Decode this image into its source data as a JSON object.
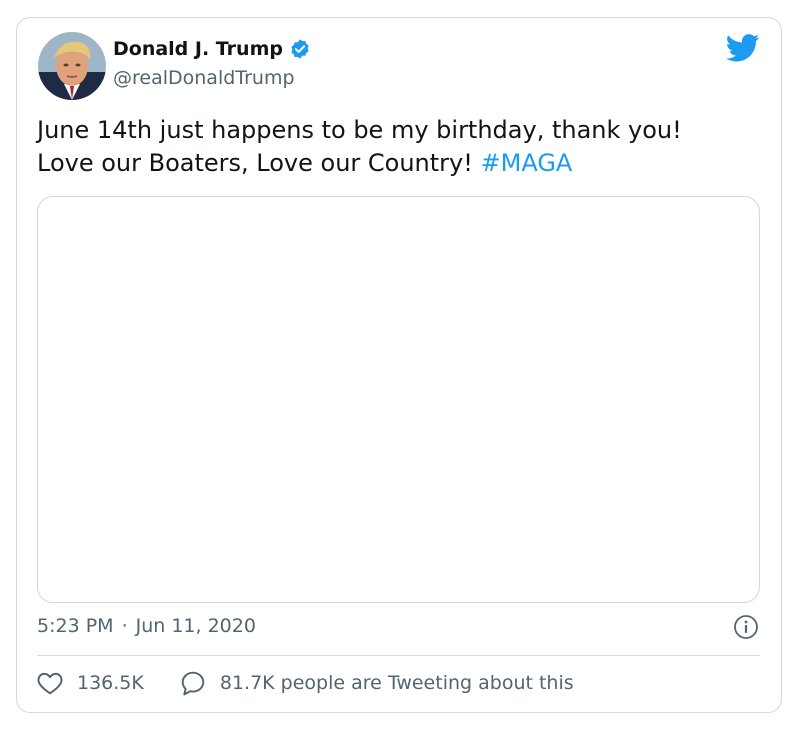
{
  "author": {
    "name": "Donald J. Trump",
    "handle": "@realDonaldTrump",
    "verified": true
  },
  "tweet": {
    "text_line1": "June 14th just happens to be my birthday, thank you!",
    "text_line2_prefix": "Love our Boaters, Love our Country! ",
    "hashtag": "#MAGA"
  },
  "meta": {
    "time": "5:23 PM",
    "separator": "·",
    "date": "Jun 11, 2020"
  },
  "stats": {
    "likes": "136.5K",
    "tweeting": "81.7K people are Tweeting about this"
  },
  "colors": {
    "accent": "#1d9bf0",
    "text": "#0f1419",
    "muted": "#536471",
    "border": "#cfd9de"
  },
  "icons": [
    "twitter-bird-icon",
    "verified-badge-icon",
    "heart-icon",
    "reply-bubble-icon",
    "info-icon"
  ]
}
